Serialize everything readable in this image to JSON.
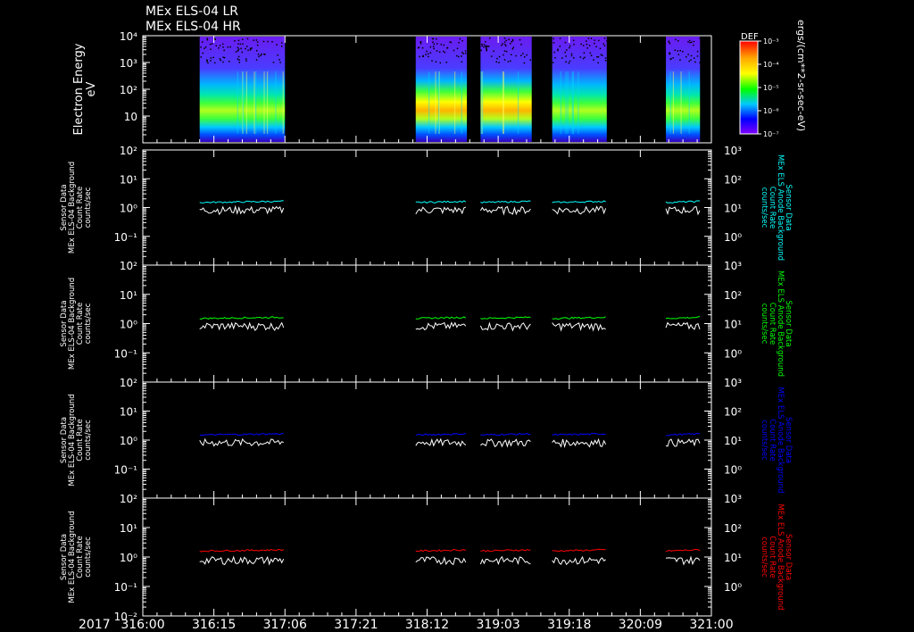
{
  "header": {
    "title_lr": "MEx ELS-04 LR",
    "title_hr": "MEx ELS-04 HR"
  },
  "colorbar": {
    "label": "DEF",
    "units": "ergs/(cm**2-sr-sec-eV)",
    "ticks": [
      "10⁻³",
      "10⁻⁴",
      "10⁻⁵",
      "10⁻⁶",
      "10⁻⁷"
    ],
    "colors": [
      "#ff0000",
      "#ffa500",
      "#ffff00",
      "#00ff00",
      "#00c8ff",
      "#0000ff",
      "#8000ff"
    ]
  },
  "time_axis": {
    "year_label": "2017",
    "ticks": [
      "316:00",
      "316:15",
      "317:06",
      "317:21",
      "318:12",
      "319:03",
      "319:18",
      "320:09",
      "321:00"
    ]
  },
  "chart_data": [
    {
      "type": "heatmap",
      "name": "spectrogram",
      "ylabel": "Electron Energy",
      "yunits": "eV",
      "yscale": "log",
      "ytick_labels": [
        "10⁴",
        "10³",
        "10²",
        "10"
      ],
      "ylim": [
        2,
        10000
      ],
      "xlim": [
        316.0,
        321.0
      ],
      "data_intervals": [
        [
          316.5,
          317.25
        ],
        [
          318.4,
          318.85
        ],
        [
          318.97,
          319.42
        ],
        [
          319.6,
          320.08
        ],
        [
          320.6,
          320.9
        ]
      ],
      "peak_energy_eV": 20,
      "units": "ergs/(cm**2-sr-sec-eV)"
    },
    {
      "type": "line",
      "name": "panel-1",
      "ylabel": [
        "Sensor Data",
        "MEx ELS-04 Background",
        "Count Rate",
        "counts/sec"
      ],
      "ylabel_right": [
        "Sensor Data",
        "MEx ELS Anode Background",
        "Count Rate",
        "counts/sec"
      ],
      "right_color": "#00ffff",
      "ytick_labels_left": [
        "10²",
        "10¹",
        "10⁰",
        "10⁻¹"
      ],
      "ytick_labels_right": [
        "10³",
        "10²",
        "10¹",
        "10⁰"
      ],
      "ylim_left": [
        0.01,
        100
      ],
      "ylim_right": [
        0.1,
        1000
      ],
      "series": [
        {
          "color": "#ffffff",
          "level": 0.9
        },
        {
          "color": "#00ffff",
          "level": 15
        }
      ]
    },
    {
      "type": "line",
      "name": "panel-2",
      "ylabel": [
        "Sensor Data",
        "MEx ELS-04 Background",
        "Count Rate",
        "counts/sec"
      ],
      "ylabel_right": [
        "Sensor Data",
        "MEx ELS Anode Background",
        "Count Rate",
        "counts/sec"
      ],
      "right_color": "#00ff00",
      "ytick_labels_left": [
        "10²",
        "10¹",
        "10⁰",
        "10⁻¹"
      ],
      "ytick_labels_right": [
        "10³",
        "10²",
        "10¹",
        "10⁰"
      ],
      "ylim_left": [
        0.01,
        100
      ],
      "ylim_right": [
        0.1,
        1000
      ],
      "series": [
        {
          "color": "#ffffff",
          "level": 0.9
        },
        {
          "color": "#00ff00",
          "level": 15
        }
      ]
    },
    {
      "type": "line",
      "name": "panel-3",
      "ylabel": [
        "Sensor Data",
        "MEx ELS-04 Background",
        "Count Rate",
        "counts/sec"
      ],
      "ylabel_right": [
        "Sensor Data",
        "MEx ELS Anode Background",
        "Count Rate",
        "counts/sec"
      ],
      "right_color": "#0000ff",
      "ytick_labels_left": [
        "10²",
        "10¹",
        "10⁰",
        "10⁻¹"
      ],
      "ytick_labels_right": [
        "10³",
        "10²",
        "10¹",
        "10⁰"
      ],
      "ylim_left": [
        0.01,
        100
      ],
      "ylim_right": [
        0.1,
        1000
      ],
      "series": [
        {
          "color": "#ffffff",
          "level": 0.9
        },
        {
          "color": "#0000ff",
          "level": 15
        }
      ]
    },
    {
      "type": "line",
      "name": "panel-4",
      "ylabel": [
        "Sensor Data",
        "MEx ELS-04 Background",
        "Count Rate",
        "counts/sec"
      ],
      "ylabel_right": [
        "Sensor Data",
        "MEx ELS Anode Background",
        "Count Rate",
        "counts/sec"
      ],
      "right_color": "#ff0000",
      "ytick_labels_left": [
        "10²",
        "10¹",
        "10⁰",
        "10⁻¹",
        "10⁻²"
      ],
      "ytick_labels_right": [
        "10³",
        "10²",
        "10¹",
        "10⁰"
      ],
      "ylim_left": [
        0.01,
        100
      ],
      "ylim_right": [
        0.1,
        1000
      ],
      "series": [
        {
          "color": "#ffffff",
          "level": 0.85
        },
        {
          "color": "#ff0000",
          "level": 16
        }
      ]
    }
  ]
}
